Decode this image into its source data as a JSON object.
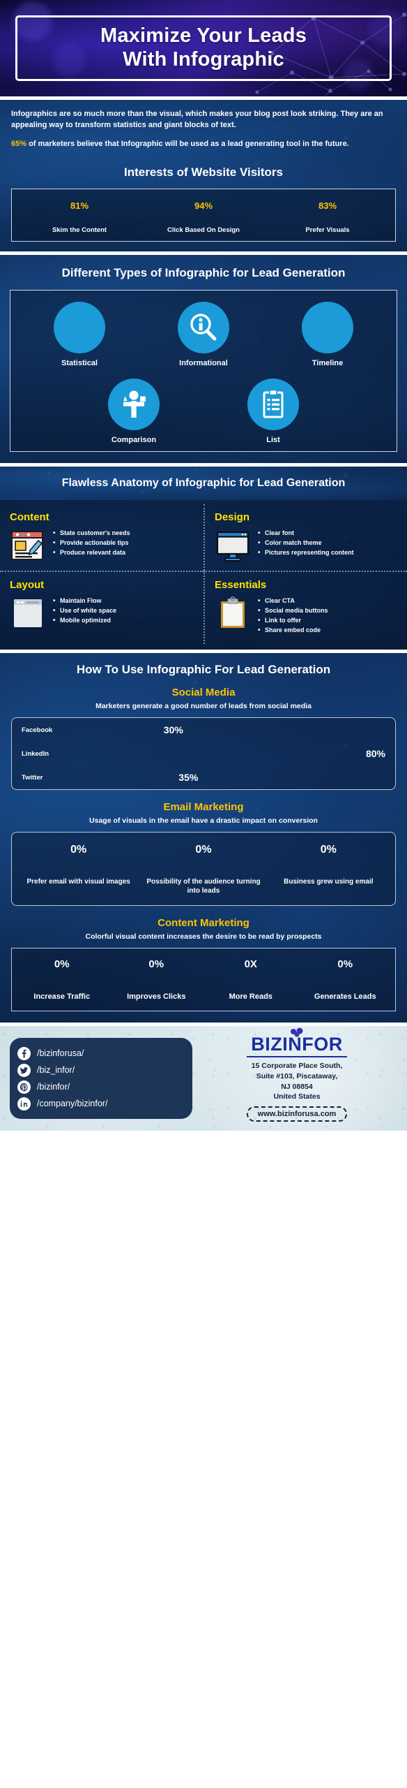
{
  "header": {
    "title_line1": "Maximize Your Leads",
    "title_line2": "With Infographic"
  },
  "intro": {
    "paragraph1": "Infographics are so much more than the visual, which makes your blog post look striking. They are an appealing way to transform statistics and giant blocks of text.",
    "highlight": "65%",
    "paragraph2_rest": " of marketers believe that Infographic will be used as a lead generating tool in the future."
  },
  "interests": {
    "title": "Interests of Website Visitors",
    "items": [
      {
        "value": "81%",
        "label": "Skim the Content"
      },
      {
        "value": "94%",
        "label": "Click Based On Design"
      },
      {
        "value": "83%",
        "label": "Prefer Visuals"
      }
    ]
  },
  "types": {
    "title": "Different Types of Infographic for Lead Generation",
    "row1": [
      {
        "label": "Statistical",
        "icon": "blank-circle-icon"
      },
      {
        "label": "Informational",
        "icon": "info-magnifier-icon"
      },
      {
        "label": "Timeline",
        "icon": "blank-circle-icon"
      }
    ],
    "row2": [
      {
        "label": "Comparison",
        "icon": "person-shapes-icon"
      },
      {
        "label": "List",
        "icon": "clipboard-list-icon"
      }
    ]
  },
  "anatomy": {
    "title": "Flawless Anatomy of Infographic for Lead Generation",
    "quadrants": [
      {
        "heading": "Content",
        "icon": "document-edit-icon",
        "bullets": [
          "State customer's needs",
          "Provide actionable tips",
          "Produce relevant data"
        ]
      },
      {
        "heading": "Design",
        "icon": "monitor-icon",
        "bullets": [
          "Clear font",
          "Color match theme",
          "Pictures representing content"
        ]
      },
      {
        "heading": "Layout",
        "icon": "browser-window-icon",
        "bullets": [
          "Maintain Flow",
          "Use of white space",
          "Mobile optimized"
        ]
      },
      {
        "heading": "Essentials",
        "icon": "clipboard-icon",
        "bullets": [
          "Clear CTA",
          "Social media buttons",
          "Link to offer",
          "Share embed code"
        ]
      }
    ]
  },
  "howto": {
    "title": "How To Use Infographic For Lead Generation",
    "social_media": {
      "heading": "Social Media",
      "description": "Marketers generate a good number of leads from social media",
      "rows": [
        {
          "name": "Facebook",
          "value": "30%"
        },
        {
          "name": "LinkedIn",
          "value": "80%"
        },
        {
          "name": "Twitter",
          "value": "35%"
        }
      ]
    },
    "email_marketing": {
      "heading": "Email Marketing",
      "description": "Usage of visuals in the email have a drastic impact on conversion",
      "items": [
        {
          "value": "0%",
          "label": "Prefer email with visual images"
        },
        {
          "value": "0%",
          "label": "Possibility of the audience turning into leads"
        },
        {
          "value": "0%",
          "label": "Business grew using email"
        }
      ]
    },
    "content_marketing": {
      "heading": "Content Marketing",
      "description": "Colorful visual content increases the desire to be read by prospects",
      "items": [
        {
          "value": "0%",
          "label": "Increase Traffic"
        },
        {
          "value": "0%",
          "label": "Improves Clicks"
        },
        {
          "value": "0X",
          "label": "More Reads"
        },
        {
          "value": "0%",
          "label": "Generates Leads"
        }
      ]
    }
  },
  "footer": {
    "social": [
      {
        "icon": "facebook-icon",
        "handle": "/bizinforusa/"
      },
      {
        "icon": "twitter-icon",
        "handle": "/biz_infor/"
      },
      {
        "icon": "pinterest-icon",
        "handle": "/bizinfor/"
      },
      {
        "icon": "linkedin-icon",
        "handle": "/company/bizinfor/"
      }
    ],
    "brand_part1": "B",
    "brand_part2": "IZ",
    "brand_i": "I",
    "brand_name": "BIZINFOR",
    "address_line1": "15 Corporate Place South,",
    "address_line2": "Suite #103, Piscataway,",
    "address_line3": "NJ 08854",
    "address_line4": "United States",
    "website": "www.bizinforusa.com"
  },
  "colors": {
    "accent_yellow": "#ffc400",
    "circle_blue": "#1b9bd8",
    "panel_blue": "#123a70",
    "brand_blue": "#1a2fa0"
  },
  "chart_data": [
    {
      "type": "bar",
      "title": "Interests of Website Visitors",
      "categories": [
        "Skim the Content",
        "Click Based On Design",
        "Prefer Visuals"
      ],
      "values": [
        81,
        94,
        83
      ],
      "xlabel": "",
      "ylabel": "",
      "ylim": [
        0,
        100
      ]
    },
    {
      "type": "bar",
      "title": "Marketers generate a good number of leads from social media",
      "categories": [
        "Facebook",
        "LinkedIn",
        "Twitter"
      ],
      "values": [
        30,
        80,
        35
      ],
      "xlabel": "",
      "ylabel": "",
      "ylim": [
        0,
        100
      ]
    },
    {
      "type": "bar",
      "title": "Email Marketing",
      "categories": [
        "Prefer email with visual images",
        "Possibility of the audience turning into leads",
        "Business grew using email"
      ],
      "values": [
        0,
        0,
        0
      ],
      "xlabel": "",
      "ylabel": "",
      "ylim": [
        0,
        100
      ]
    },
    {
      "type": "bar",
      "title": "Content Marketing",
      "categories": [
        "Increase Traffic",
        "Improves Clicks",
        "More Reads",
        "Generates Leads"
      ],
      "values": [
        0,
        0,
        0,
        0
      ],
      "xlabel": "",
      "ylabel": "",
      "ylim": [
        0,
        100
      ]
    }
  ]
}
